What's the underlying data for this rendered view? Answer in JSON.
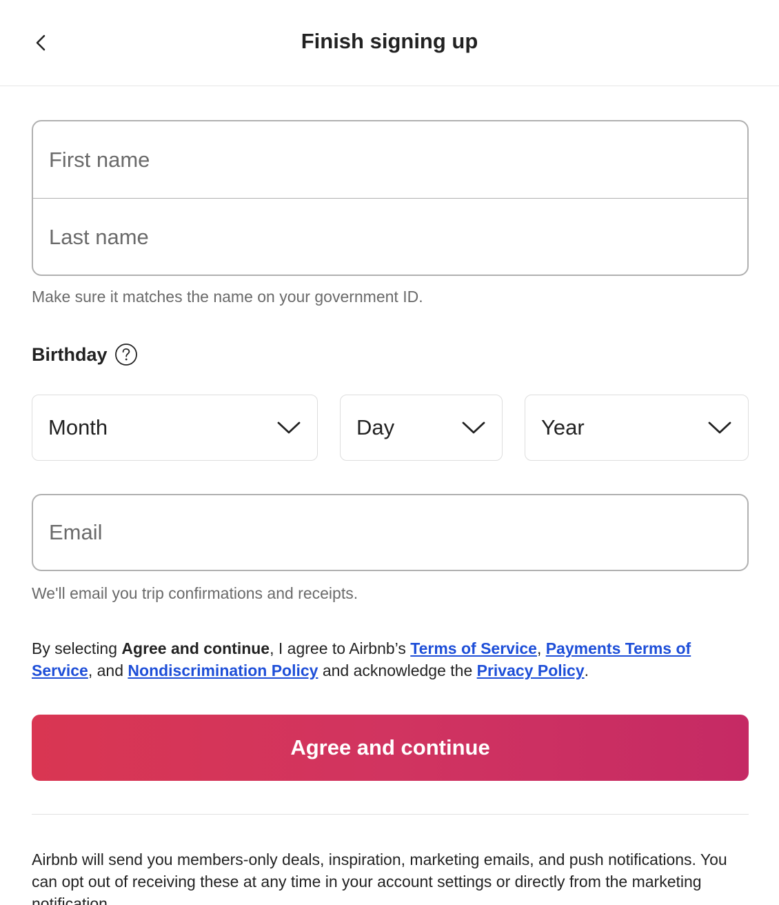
{
  "header": {
    "title": "Finish signing up",
    "back_icon": "chevron-left-icon"
  },
  "name_fields": {
    "first_placeholder": "First name",
    "last_placeholder": "Last name",
    "hint": "Make sure it matches the name on your government ID."
  },
  "birthday": {
    "label": "Birthday",
    "help_icon": "question-circle-icon",
    "month": "Month",
    "day": "Day",
    "year": "Year"
  },
  "email": {
    "placeholder": "Email",
    "hint": "We'll email you trip confirmations and receipts."
  },
  "legal": {
    "prefix": "By selecting ",
    "bold": "Agree and continue",
    "mid1": ", I agree to Airbnb’s ",
    "terms_link": "Terms of Service",
    "comma": ", ",
    "payments_link": "Payments Terms of Service",
    "and": ", and ",
    "nondiscrimination_link": "Nondiscrimination Policy",
    "acknowledge": " and acknowledge the ",
    "privacy_link": "Privacy Policy",
    "period": "."
  },
  "cta": {
    "label": "Agree and continue",
    "gradient_start": "#d93652",
    "gradient_end": "#c52a64"
  },
  "marketing": {
    "text": "Airbnb will send you members-only deals, inspiration, marketing emails, and push notifications. You can opt out of receiving these at any time in your account settings or directly from the marketing notification."
  },
  "colors": {
    "link": "#1d4ed8",
    "text": "#222222",
    "muted": "#6a6a6a"
  }
}
